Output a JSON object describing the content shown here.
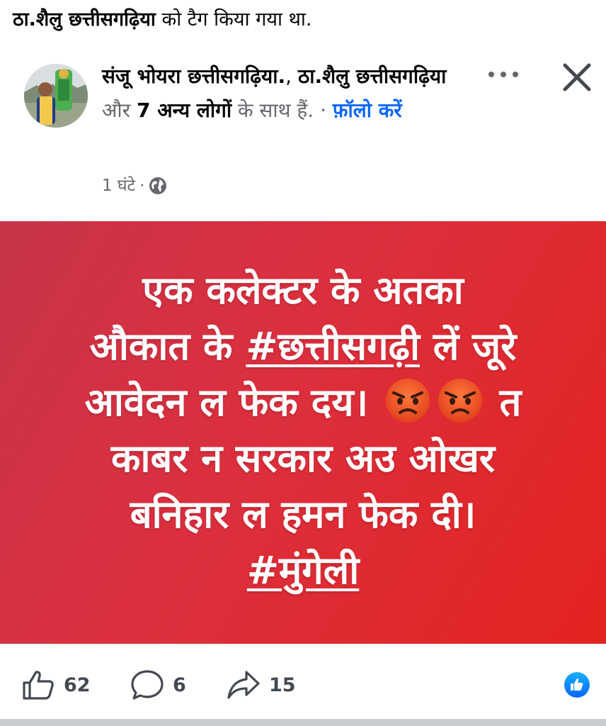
{
  "tag_line": {
    "name": "ठा.शैलु छत्तीसगढ़िया",
    "suffix": " को टैग किया गया था."
  },
  "post_header": {
    "author": "संजू भोयरा छत्तीसगढ़िया.",
    "separator": ", ",
    "tagged_person": "ठा.शैलु छत्तीसगढ़िया",
    "conjunction": " और ",
    "others": "7 अन्य लोगों",
    "with_text": " के साथ हैं.",
    "dot": " · ",
    "follow_label": "फ़ॉलो करें",
    "time": "1 घंटे",
    "time_sep": "·",
    "audience_icon": "globe-icon",
    "more_icon": "more-icon",
    "close_icon": "close-icon"
  },
  "post_content": {
    "line1": "एक कलेक्टर के अतका",
    "line2_pre": "औकात के ",
    "hashtag1": "#छत्तीसगढ़ी",
    "line2_post": " लें जूरे",
    "line3_pre": "आवेदन ल फेक दय। ",
    "line3_post": " त",
    "line4": "काबर न सरकार अउ ओखर",
    "line5": "बनिहार ल हमन फेक दी।",
    "hashtag2": "#मुंगेली",
    "emoji": "angry-face",
    "background": "#dc2f3d"
  },
  "actions": {
    "like_count": "62",
    "comment_count": "6",
    "share_count": "15",
    "like_icon": "thumbs-up-icon",
    "comment_icon": "comment-icon",
    "share_icon": "share-icon",
    "reaction_icon": "like-reaction-icon",
    "accent": "#0866ff"
  }
}
